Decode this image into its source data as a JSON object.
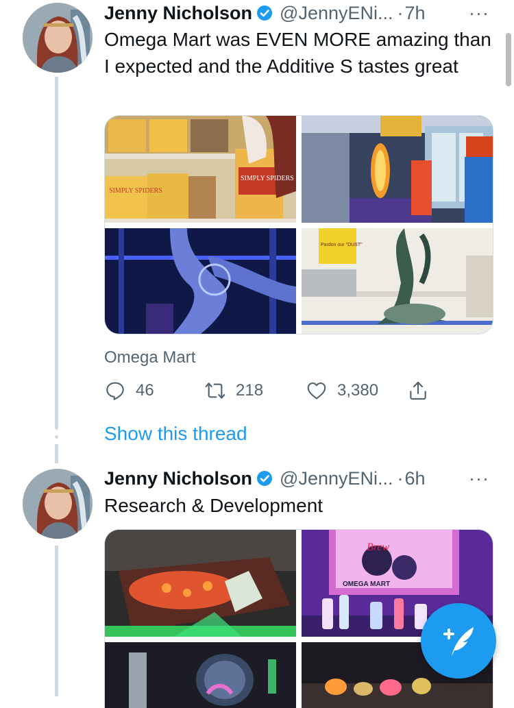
{
  "tweets": [
    {
      "author_name": "Jenny Nicholson",
      "author_handle": "@JennyENi...",
      "separator": "·",
      "time": "7h",
      "more": "···",
      "text": "Omega Mart was EVEN MORE amazing than I expected and the Additive S tastes great",
      "media": [
        "cereal-boxes-photo",
        "glowing-corn-photo",
        "blue-tube-slide-photo",
        "shelf-sculpture-photo"
      ],
      "media_text": {
        "cereal_brand": "SIMPLY SPIDERS",
        "sign_text": "Pardon our \"DUST\""
      },
      "location": "Omega Mart",
      "replies": "46",
      "retweets": "218",
      "likes": "3,380",
      "show_thread": "Show this thread"
    },
    {
      "author_name": "Jenny Nicholson",
      "author_handle": "@JennyENi...",
      "separator": "·",
      "time": "6h",
      "more": "···",
      "text": "Research & Development",
      "media": [
        "glowing-table-photo",
        "bottles-display-photo",
        "lab-equipment-photo",
        "jars-display-photo"
      ],
      "media_text": {
        "sign_brand": "OMEGA MART",
        "sign_script": "Brew"
      }
    }
  ],
  "colors": {
    "accent": "#1d9bf0",
    "secondary_text": "#536471",
    "thread_line": "#cfd9de"
  },
  "compose_button": {
    "icon": "compose-feather-icon"
  }
}
